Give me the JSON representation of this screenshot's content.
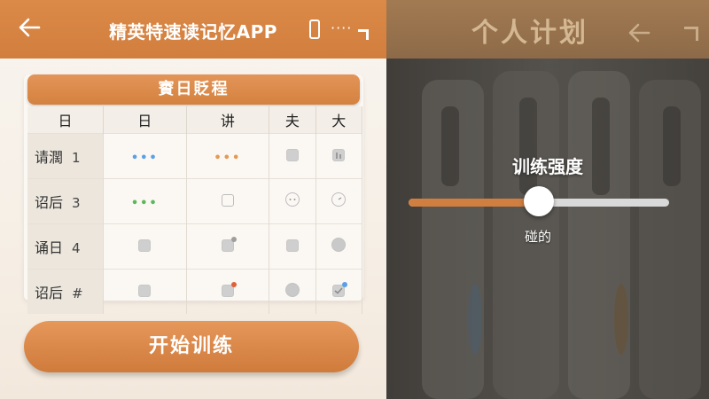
{
  "left": {
    "header": {
      "title": "精英特速读记忆APP",
      "dots": "····"
    },
    "schedule": {
      "title": "賨日貶程",
      "columns": [
        "日",
        "日",
        "讲",
        "夫",
        "大"
      ],
      "rows": [
        {
          "label": "请濶",
          "num": "1",
          "cells": [
            {
              "type": "dots",
              "color": "#5aa0e6"
            },
            {
              "type": "dots",
              "color": "#e39a52"
            },
            {
              "type": "square-fill"
            },
            {
              "type": "square-bars"
            }
          ]
        },
        {
          "label": "诏后",
          "num": "3",
          "cells": [
            {
              "type": "dots",
              "color": "#5db85a"
            },
            {
              "type": "square"
            },
            {
              "type": "circle-face"
            },
            {
              "type": "circle-clock"
            }
          ]
        },
        {
          "label": "诵日",
          "num": "4",
          "cells": [
            {
              "type": "square-fill"
            },
            {
              "type": "square-fill-badge",
              "badge": "#9e9e9e"
            },
            {
              "type": "square-fill"
            },
            {
              "type": "circle-fill"
            }
          ]
        },
        {
          "label": "诏后",
          "num": "#",
          "cells": [
            {
              "type": "square-fill"
            },
            {
              "type": "square-fill-badge",
              "badge": "#e0603a"
            },
            {
              "type": "circle-fill"
            },
            {
              "type": "square-check-badge",
              "badge": "#5aa0e6"
            }
          ]
        }
      ]
    },
    "start_button": "开始训练"
  },
  "right": {
    "header": {
      "title": "个人计划"
    },
    "intensity": {
      "label": "训练强度",
      "value_label": "碰的",
      "value": 0.5
    },
    "colors": {
      "accent": "#d17f40"
    }
  }
}
